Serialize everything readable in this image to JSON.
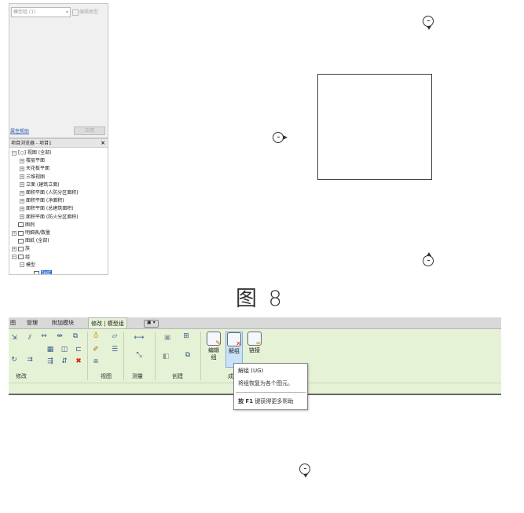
{
  "properties": {
    "type_selector": "模型组 (1)",
    "edit_type": "编辑类型",
    "help_link": "属性帮助",
    "apply_button": "应用"
  },
  "browser": {
    "title": "项目浏览器 - 项目1",
    "close": "×",
    "items": [
      {
        "toggle": "−",
        "label": "[○] 视图 (全部)",
        "indent": 0
      },
      {
        "toggle": "+",
        "label": "楼层平面",
        "indent": 1
      },
      {
        "toggle": "+",
        "label": "天花板平面",
        "indent": 1
      },
      {
        "toggle": "+",
        "label": "三维视图",
        "indent": 1
      },
      {
        "toggle": "+",
        "label": "立面 (建筑立面)",
        "indent": 1
      },
      {
        "toggle": "+",
        "label": "面积平面 (人防分区面积)",
        "indent": 1
      },
      {
        "toggle": "+",
        "label": "面积平面 (净面积)",
        "indent": 1
      },
      {
        "toggle": "+",
        "label": "面积平面 (总建筑面积)",
        "indent": 1
      },
      {
        "toggle": "+",
        "label": "面积平面 (防火分区面积)",
        "indent": 1
      },
      {
        "toggle": "",
        "label": "图例",
        "indent": 0
      },
      {
        "toggle": "+",
        "label": "明细表/数量",
        "indent": 0
      },
      {
        "toggle": "",
        "label": "图纸 (全部)",
        "indent": 0
      },
      {
        "toggle": "+",
        "label": "族",
        "indent": 0
      },
      {
        "toggle": "−",
        "label": "组",
        "indent": 0
      },
      {
        "toggle": "−",
        "label": "模型",
        "indent": 1
      },
      {
        "toggle": "",
        "label": "test",
        "indent": 2,
        "selected": true
      }
    ]
  },
  "figure_caption": "图 8",
  "ribbon": {
    "tabs": [
      "图",
      "管理",
      "附加模块",
      "修改 | 模型组",
      "▣ ▾"
    ],
    "panels": {
      "modify": "修改",
      "view": "视图",
      "measure": "测量",
      "create": "创建",
      "group_partial": "成"
    },
    "buttons": {
      "edit_group": [
        "编辑",
        "组"
      ],
      "ungroup": "解组",
      "link": "链接"
    },
    "tooltip": {
      "title": "解组 (UG)",
      "description": "将组恢复为各个图元。",
      "help_key": "按 F1",
      "help_rest": " 键获得更多帮助"
    }
  }
}
